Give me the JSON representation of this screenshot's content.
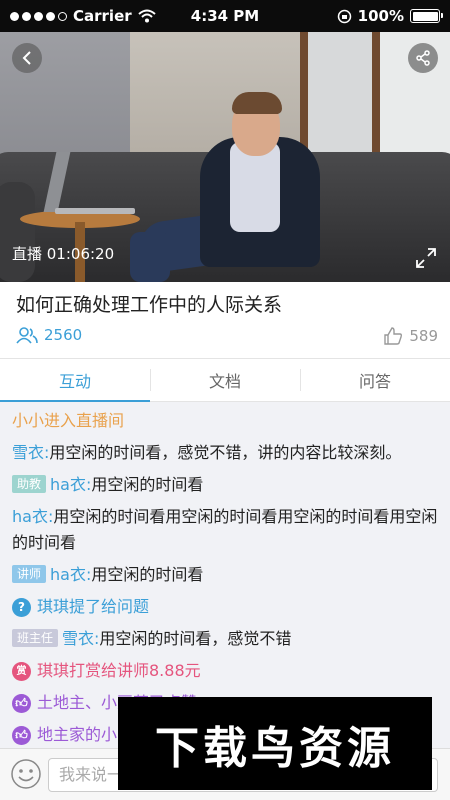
{
  "status_bar": {
    "carrier": "Carrier",
    "time": "4:34 PM",
    "battery": "100%"
  },
  "video": {
    "live_time": "直播 01:06:20"
  },
  "course": {
    "title": "如何正确处理工作中的人际关系",
    "viewers": "2560",
    "likes": "589"
  },
  "tabs": [
    {
      "label": "互动",
      "active": true
    },
    {
      "label": "文档",
      "active": false
    },
    {
      "label": "问答",
      "active": false
    }
  ],
  "chat": {
    "enter": "小小进入直播间",
    "m1": {
      "user": "雪衣:",
      "text": "用空闲的时间看，感觉不错，讲的内容比较深刻。"
    },
    "m2": {
      "badge": "助教",
      "user": "ha衣:",
      "text": "用空闲的时间看"
    },
    "m3": {
      "user": "ha衣:",
      "text": "用空闲的时间看用空闲的时间看用空闲的时间看用空闲的时间看"
    },
    "m4": {
      "badge": "讲师",
      "user": "ha衣:",
      "text": "用空闲的时间看"
    },
    "question": {
      "icon": "?",
      "text": "琪琪提了给问题"
    },
    "m5": {
      "badge": "班主任",
      "user": "雪衣:",
      "text": "用空闲的时间看，感觉不错"
    },
    "reward": {
      "icon": "赏",
      "text": "琪琪打赏给讲师8.88元"
    },
    "like1": {
      "text": "土地主、小豆芽已点赞"
    },
    "like2": {
      "text": "地主家的小"
    }
  },
  "input": {
    "placeholder": "我来说一"
  },
  "watermark": "下载鸟资源",
  "colors": {
    "accent": "#3b9fd7",
    "orange": "#e9a24d",
    "pink": "#e5557e",
    "purple": "#9c5ad6"
  }
}
